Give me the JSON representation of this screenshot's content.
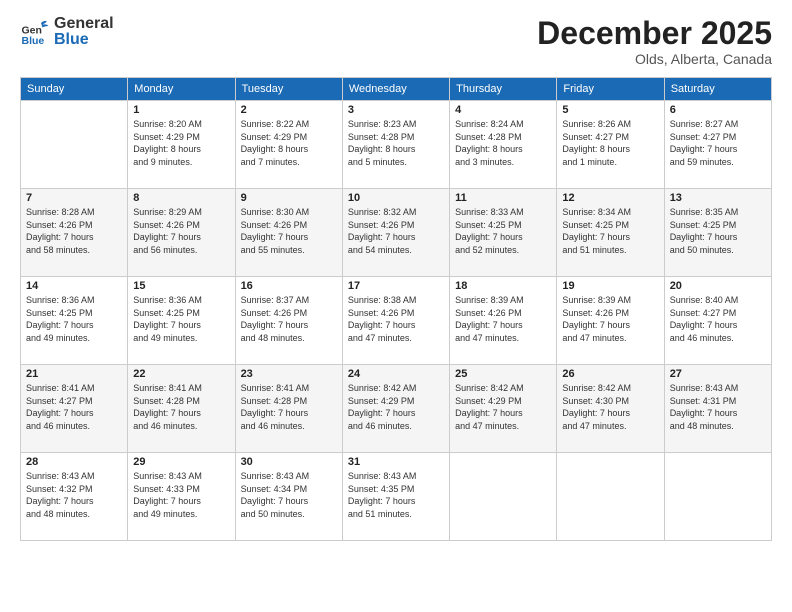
{
  "header": {
    "logo_general": "General",
    "logo_blue": "Blue",
    "month_title": "December 2025",
    "location": "Olds, Alberta, Canada"
  },
  "weekdays": [
    "Sunday",
    "Monday",
    "Tuesday",
    "Wednesday",
    "Thursday",
    "Friday",
    "Saturday"
  ],
  "weeks": [
    [
      {
        "day": "",
        "info": ""
      },
      {
        "day": "1",
        "info": "Sunrise: 8:20 AM\nSunset: 4:29 PM\nDaylight: 8 hours\nand 9 minutes."
      },
      {
        "day": "2",
        "info": "Sunrise: 8:22 AM\nSunset: 4:29 PM\nDaylight: 8 hours\nand 7 minutes."
      },
      {
        "day": "3",
        "info": "Sunrise: 8:23 AM\nSunset: 4:28 PM\nDaylight: 8 hours\nand 5 minutes."
      },
      {
        "day": "4",
        "info": "Sunrise: 8:24 AM\nSunset: 4:28 PM\nDaylight: 8 hours\nand 3 minutes."
      },
      {
        "day": "5",
        "info": "Sunrise: 8:26 AM\nSunset: 4:27 PM\nDaylight: 8 hours\nand 1 minute."
      },
      {
        "day": "6",
        "info": "Sunrise: 8:27 AM\nSunset: 4:27 PM\nDaylight: 7 hours\nand 59 minutes."
      }
    ],
    [
      {
        "day": "7",
        "info": "Sunrise: 8:28 AM\nSunset: 4:26 PM\nDaylight: 7 hours\nand 58 minutes."
      },
      {
        "day": "8",
        "info": "Sunrise: 8:29 AM\nSunset: 4:26 PM\nDaylight: 7 hours\nand 56 minutes."
      },
      {
        "day": "9",
        "info": "Sunrise: 8:30 AM\nSunset: 4:26 PM\nDaylight: 7 hours\nand 55 minutes."
      },
      {
        "day": "10",
        "info": "Sunrise: 8:32 AM\nSunset: 4:26 PM\nDaylight: 7 hours\nand 54 minutes."
      },
      {
        "day": "11",
        "info": "Sunrise: 8:33 AM\nSunset: 4:25 PM\nDaylight: 7 hours\nand 52 minutes."
      },
      {
        "day": "12",
        "info": "Sunrise: 8:34 AM\nSunset: 4:25 PM\nDaylight: 7 hours\nand 51 minutes."
      },
      {
        "day": "13",
        "info": "Sunrise: 8:35 AM\nSunset: 4:25 PM\nDaylight: 7 hours\nand 50 minutes."
      }
    ],
    [
      {
        "day": "14",
        "info": "Sunrise: 8:36 AM\nSunset: 4:25 PM\nDaylight: 7 hours\nand 49 minutes."
      },
      {
        "day": "15",
        "info": "Sunrise: 8:36 AM\nSunset: 4:25 PM\nDaylight: 7 hours\nand 49 minutes."
      },
      {
        "day": "16",
        "info": "Sunrise: 8:37 AM\nSunset: 4:26 PM\nDaylight: 7 hours\nand 48 minutes."
      },
      {
        "day": "17",
        "info": "Sunrise: 8:38 AM\nSunset: 4:26 PM\nDaylight: 7 hours\nand 47 minutes."
      },
      {
        "day": "18",
        "info": "Sunrise: 8:39 AM\nSunset: 4:26 PM\nDaylight: 7 hours\nand 47 minutes."
      },
      {
        "day": "19",
        "info": "Sunrise: 8:39 AM\nSunset: 4:26 PM\nDaylight: 7 hours\nand 47 minutes."
      },
      {
        "day": "20",
        "info": "Sunrise: 8:40 AM\nSunset: 4:27 PM\nDaylight: 7 hours\nand 46 minutes."
      }
    ],
    [
      {
        "day": "21",
        "info": "Sunrise: 8:41 AM\nSunset: 4:27 PM\nDaylight: 7 hours\nand 46 minutes."
      },
      {
        "day": "22",
        "info": "Sunrise: 8:41 AM\nSunset: 4:28 PM\nDaylight: 7 hours\nand 46 minutes."
      },
      {
        "day": "23",
        "info": "Sunrise: 8:41 AM\nSunset: 4:28 PM\nDaylight: 7 hours\nand 46 minutes."
      },
      {
        "day": "24",
        "info": "Sunrise: 8:42 AM\nSunset: 4:29 PM\nDaylight: 7 hours\nand 46 minutes."
      },
      {
        "day": "25",
        "info": "Sunrise: 8:42 AM\nSunset: 4:29 PM\nDaylight: 7 hours\nand 47 minutes."
      },
      {
        "day": "26",
        "info": "Sunrise: 8:42 AM\nSunset: 4:30 PM\nDaylight: 7 hours\nand 47 minutes."
      },
      {
        "day": "27",
        "info": "Sunrise: 8:43 AM\nSunset: 4:31 PM\nDaylight: 7 hours\nand 48 minutes."
      }
    ],
    [
      {
        "day": "28",
        "info": "Sunrise: 8:43 AM\nSunset: 4:32 PM\nDaylight: 7 hours\nand 48 minutes."
      },
      {
        "day": "29",
        "info": "Sunrise: 8:43 AM\nSunset: 4:33 PM\nDaylight: 7 hours\nand 49 minutes."
      },
      {
        "day": "30",
        "info": "Sunrise: 8:43 AM\nSunset: 4:34 PM\nDaylight: 7 hours\nand 50 minutes."
      },
      {
        "day": "31",
        "info": "Sunrise: 8:43 AM\nSunset: 4:35 PM\nDaylight: 7 hours\nand 51 minutes."
      },
      {
        "day": "",
        "info": ""
      },
      {
        "day": "",
        "info": ""
      },
      {
        "day": "",
        "info": ""
      }
    ]
  ]
}
